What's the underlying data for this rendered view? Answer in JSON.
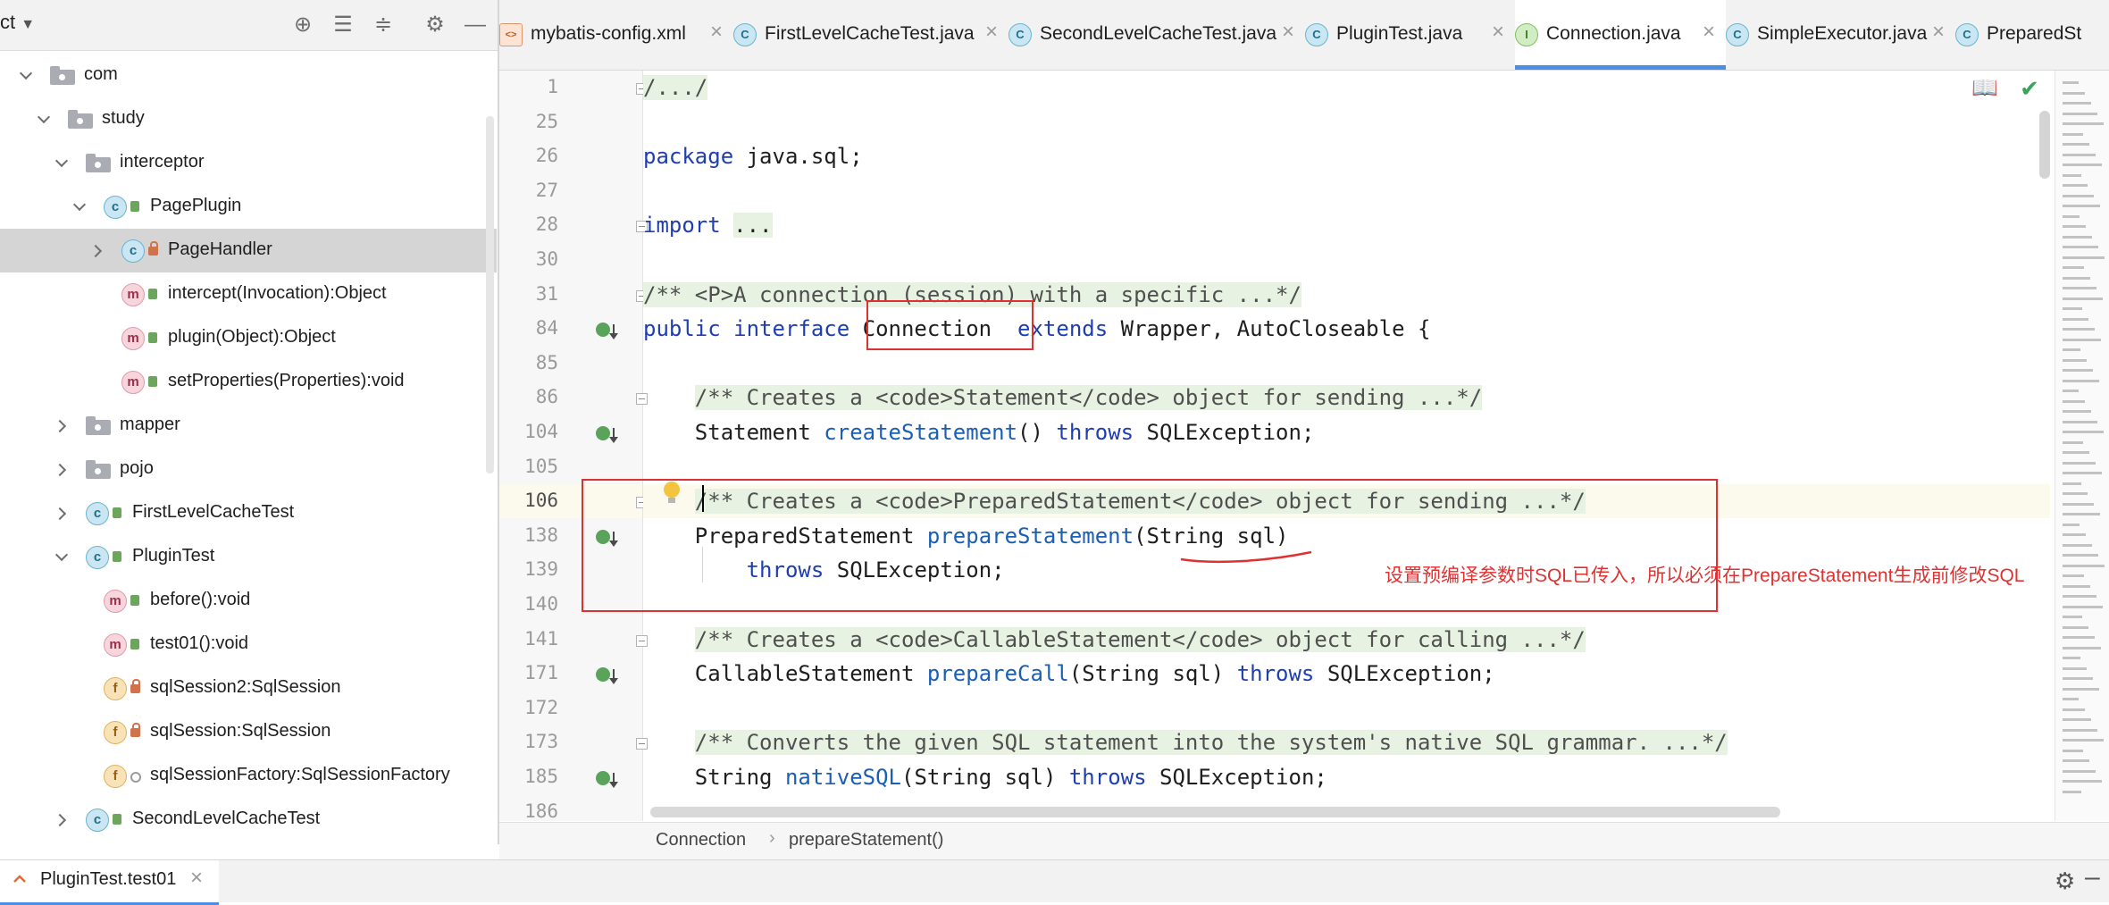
{
  "sidebar": {
    "title": "ct",
    "tree": [
      {
        "label": "com",
        "indent": 0,
        "kind": "package",
        "chevron": "down",
        "visibility": ""
      },
      {
        "label": "study",
        "indent": 1,
        "kind": "package",
        "chevron": "down",
        "visibility": ""
      },
      {
        "label": "interceptor",
        "indent": 2,
        "kind": "package",
        "chevron": "down",
        "visibility": ""
      },
      {
        "label": "PagePlugin",
        "indent": 3,
        "kind": "class",
        "chevron": "down",
        "visibility": "public"
      },
      {
        "label": "PageHandler",
        "indent": 4,
        "kind": "class",
        "chevron": "right",
        "visibility": "private",
        "selected": true
      },
      {
        "label": "intercept(Invocation):Object",
        "indent": 4,
        "kind": "method",
        "chevron": "",
        "visibility": "public"
      },
      {
        "label": "plugin(Object):Object",
        "indent": 4,
        "kind": "method",
        "chevron": "",
        "visibility": "public"
      },
      {
        "label": "setProperties(Properties):void",
        "indent": 4,
        "kind": "method",
        "chevron": "",
        "visibility": "public"
      },
      {
        "label": "mapper",
        "indent": 2,
        "kind": "package",
        "chevron": "right",
        "visibility": ""
      },
      {
        "label": "pojo",
        "indent": 2,
        "kind": "package",
        "chevron": "right",
        "visibility": ""
      },
      {
        "label": "FirstLevelCacheTest",
        "indent": 2,
        "kind": "class",
        "chevron": "right",
        "visibility": "public"
      },
      {
        "label": "PluginTest",
        "indent": 2,
        "kind": "class",
        "chevron": "down",
        "visibility": "public"
      },
      {
        "label": "before():void",
        "indent": 3,
        "kind": "method",
        "chevron": "",
        "visibility": "public"
      },
      {
        "label": "test01():void",
        "indent": 3,
        "kind": "method",
        "chevron": "",
        "visibility": "public"
      },
      {
        "label": "sqlSession2:SqlSession",
        "indent": 3,
        "kind": "field",
        "chevron": "",
        "visibility": "private"
      },
      {
        "label": "sqlSession:SqlSession",
        "indent": 3,
        "kind": "field",
        "chevron": "",
        "visibility": "private"
      },
      {
        "label": "sqlSessionFactory:SqlSessionFactory",
        "indent": 3,
        "kind": "field",
        "chevron": "",
        "visibility": "package"
      },
      {
        "label": "SecondLevelCacheTest",
        "indent": 2,
        "kind": "class",
        "chevron": "right",
        "visibility": "public"
      }
    ]
  },
  "tabs": [
    {
      "label": "mybatis-config.xml",
      "icon": "xml",
      "active": false
    },
    {
      "label": "FirstLevelCacheTest.java",
      "icon": "class",
      "active": false
    },
    {
      "label": "SecondLevelCacheTest.java",
      "icon": "class",
      "active": false
    },
    {
      "label": "PluginTest.java",
      "icon": "class",
      "active": false
    },
    {
      "label": "Connection.java",
      "icon": "interface",
      "active": true
    },
    {
      "label": "SimpleExecutor.java",
      "icon": "class",
      "active": false
    },
    {
      "label": "PreparedSt",
      "icon": "class",
      "active": false
    }
  ],
  "editor": {
    "lines": [
      {
        "num": "1",
        "fold": true,
        "impl": false,
        "tokens": [
          {
            "t": "/.../",
            "c": "cm fold-bg"
          }
        ]
      },
      {
        "num": "25",
        "fold": false,
        "impl": false,
        "tokens": []
      },
      {
        "num": "26",
        "fold": false,
        "impl": false,
        "tokens": [
          {
            "t": "package",
            "c": "kw"
          },
          {
            "t": " java.sql;",
            "c": ""
          }
        ]
      },
      {
        "num": "27",
        "fold": false,
        "impl": false,
        "tokens": []
      },
      {
        "num": "28",
        "fold": true,
        "impl": false,
        "tokens": [
          {
            "t": "import",
            "c": "kw"
          },
          {
            "t": " ",
            "c": ""
          },
          {
            "t": "...",
            "c": "fold-bg"
          }
        ]
      },
      {
        "num": "30",
        "fold": false,
        "impl": false,
        "tokens": []
      },
      {
        "num": "31",
        "fold": true,
        "impl": false,
        "tokens": [
          {
            "t": "/** <P>A connection (session) with a specific ...*/",
            "c": "cm fold-bg"
          }
        ]
      },
      {
        "num": "84",
        "fold": false,
        "impl": true,
        "tokens": [
          {
            "t": "public interface",
            "c": "kw"
          },
          {
            "t": " Connection  ",
            "c": ""
          },
          {
            "t": "extends",
            "c": "kw"
          },
          {
            "t": " Wrapper, AutoCloseable {",
            "c": ""
          }
        ]
      },
      {
        "num": "85",
        "fold": false,
        "impl": false,
        "tokens": []
      },
      {
        "num": "86",
        "fold": true,
        "impl": false,
        "tokens": [
          {
            "t": "    ",
            "c": ""
          },
          {
            "t": "/** Creates a <code>Statement</code> object for sending ...*/",
            "c": "cm fold-bg"
          }
        ]
      },
      {
        "num": "104",
        "fold": false,
        "impl": true,
        "tokens": [
          {
            "t": "    Statement ",
            "c": ""
          },
          {
            "t": "createStatement",
            "c": "fn"
          },
          {
            "t": "() ",
            "c": ""
          },
          {
            "t": "throws",
            "c": "kw"
          },
          {
            "t": " SQLException;",
            "c": ""
          }
        ]
      },
      {
        "num": "105",
        "fold": false,
        "impl": false,
        "tokens": []
      },
      {
        "num": "106",
        "fold": true,
        "impl": false,
        "current": true,
        "tokens": [
          {
            "t": "    ",
            "c": ""
          },
          {
            "t": "/** Creates a <code>PreparedStatement</code> object for sending ...*/",
            "c": "cm fold-bg"
          }
        ]
      },
      {
        "num": "138",
        "fold": false,
        "impl": true,
        "tokens": [
          {
            "t": "    PreparedStatement ",
            "c": ""
          },
          {
            "t": "prepareStatement",
            "c": "fn"
          },
          {
            "t": "(String sql)",
            "c": ""
          }
        ]
      },
      {
        "num": "139",
        "fold": false,
        "impl": false,
        "tokens": [
          {
            "t": "        ",
            "c": ""
          },
          {
            "t": "throws",
            "c": "kw"
          },
          {
            "t": " SQLException;",
            "c": ""
          }
        ]
      },
      {
        "num": "140",
        "fold": false,
        "impl": false,
        "tokens": []
      },
      {
        "num": "141",
        "fold": true,
        "impl": false,
        "tokens": [
          {
            "t": "    ",
            "c": ""
          },
          {
            "t": "/** Creates a <code>CallableStatement</code> object for calling ...*/",
            "c": "cm fold-bg"
          }
        ]
      },
      {
        "num": "171",
        "fold": false,
        "impl": true,
        "tokens": [
          {
            "t": "    CallableStatement ",
            "c": ""
          },
          {
            "t": "prepareCall",
            "c": "fn"
          },
          {
            "t": "(String sql) ",
            "c": ""
          },
          {
            "t": "throws",
            "c": "kw"
          },
          {
            "t": " SQLException;",
            "c": ""
          }
        ]
      },
      {
        "num": "172",
        "fold": false,
        "impl": false,
        "tokens": []
      },
      {
        "num": "173",
        "fold": true,
        "impl": false,
        "tokens": [
          {
            "t": "    ",
            "c": ""
          },
          {
            "t": "/** Converts the given SQL statement into the system's native SQL grammar. ...*/",
            "c": "cm fold-bg"
          }
        ]
      },
      {
        "num": "185",
        "fold": false,
        "impl": true,
        "tokens": [
          {
            "t": "    String ",
            "c": ""
          },
          {
            "t": "nativeSQL",
            "c": "fn"
          },
          {
            "t": "(String sql) ",
            "c": ""
          },
          {
            "t": "throws",
            "c": "kw"
          },
          {
            "t": " SQLException;",
            "c": ""
          }
        ]
      },
      {
        "num": "186",
        "fold": false,
        "impl": false,
        "tokens": []
      }
    ]
  },
  "annotation": {
    "note": "设置预编译参数时SQL已传入，所以必须在PrepareStatement生成前修改SQL"
  },
  "breadcrumb": [
    "Connection",
    "prepareStatement()"
  ],
  "run": {
    "tab_label": "PluginTest.test01"
  },
  "colors": {
    "accent": "#4a8fe3",
    "annotation": "#e03131",
    "keyword": "#1f3eb0",
    "method": "#1a5fb4"
  }
}
